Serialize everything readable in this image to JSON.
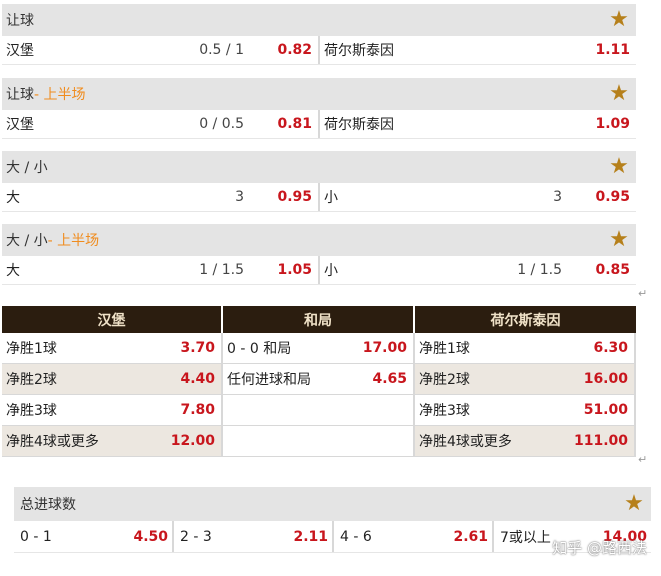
{
  "handicap": {
    "title": "让球",
    "home": "汉堡",
    "home_line": "0.5 / 1",
    "home_odd": "0.82",
    "away": "荷尔斯泰因",
    "away_odd": "1.11"
  },
  "handicap_half": {
    "title": "让球",
    "sub": " - 上半场",
    "home": "汉堡",
    "home_line": "0 / 0.5",
    "home_odd": "0.81",
    "away": "荷尔斯泰因",
    "away_odd": "1.09"
  },
  "total": {
    "title": "大 / 小",
    "over": "大",
    "over_line": "3",
    "over_odd": "0.95",
    "under": "小",
    "under_line": "3",
    "under_odd": "0.95"
  },
  "total_half": {
    "title": "大 / 小",
    "sub": " - 上半场",
    "over": "大",
    "over_line": "1 / 1.5",
    "over_odd": "1.05",
    "under": "小",
    "under_line": "1 / 1.5",
    "under_odd": "0.85"
  },
  "margin": {
    "headers": [
      "汉堡",
      "和局",
      "荷尔斯泰因"
    ],
    "rows": [
      {
        "h": "净胜1球",
        "hv": "3.70",
        "d": "0 - 0 和局",
        "dv": "17.00",
        "a": "净胜1球",
        "av": "6.30"
      },
      {
        "h": "净胜2球",
        "hv": "4.40",
        "d": "任何进球和局",
        "dv": "4.65",
        "a": "净胜2球",
        "av": "16.00"
      },
      {
        "h": "净胜3球",
        "hv": "7.80",
        "d": "",
        "dv": "",
        "a": "净胜3球",
        "av": "51.00"
      },
      {
        "h": "净胜4球或更多",
        "hv": "12.00",
        "d": "",
        "dv": "",
        "a": "净胜4球或更多",
        "av": "111.00"
      }
    ]
  },
  "total_goals": {
    "title": "总进球数",
    "items": [
      {
        "label": "0 - 1",
        "odd": "4.50"
      },
      {
        "label": "2 - 3",
        "odd": "2.11"
      },
      {
        "label": "4 - 6",
        "odd": "2.61"
      },
      {
        "label": "7或以上",
        "odd": "14.00"
      }
    ]
  },
  "watermark": "知乎 @路西法",
  "star_icon": "★",
  "return_mark": "↵",
  "colors": {
    "odd": "#c8161d",
    "accent": "#f08c1e",
    "header_bg": "#2b1d0f",
    "star": "#b6801b"
  }
}
